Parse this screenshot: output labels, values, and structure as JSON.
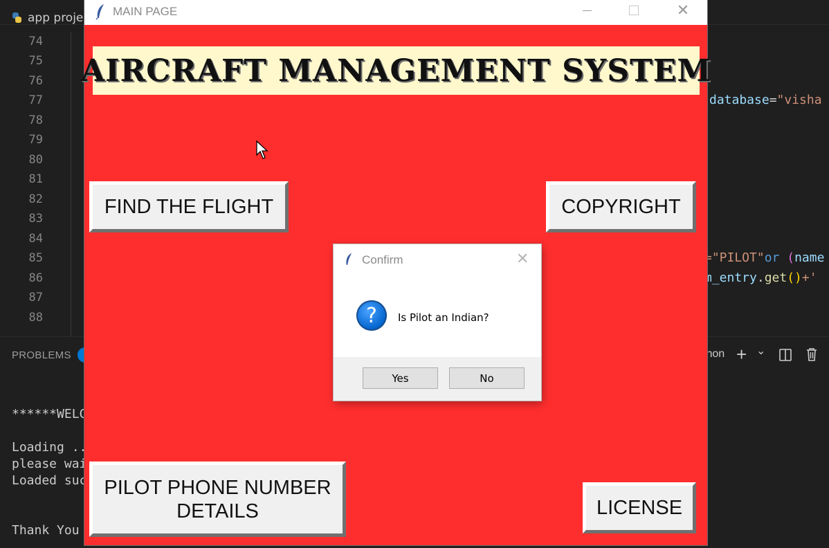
{
  "vscode": {
    "tab_title": "app proje",
    "line_numbers": [
      "74",
      "75",
      "76",
      "77",
      "78",
      "79",
      "80",
      "81",
      "82",
      "83",
      "84",
      "85",
      "86",
      "87",
      "88"
    ],
    "code": {
      "l77_attr": "database",
      "l77_eq": "=",
      "l77_str": "\"visha",
      "l85_str": "=\"PILOT\"",
      "l85_kw": "or",
      "l85_par": "(",
      "l85_attr": "name",
      "l86_attr": "m_entry",
      "l86_dot": ".",
      "l86_fn": "get",
      "l86_brk": "()",
      "l86_rest": "+'"
    },
    "panel": {
      "tab_label": "PROBLEMS",
      "right_text": "thon",
      "plus": "+",
      "chevron": "⌄"
    },
    "terminal_lines": [
      "******WELC",
      "",
      "Loading ..",
      "please wai",
      "Loaded suc",
      "",
      "",
      "Thank You"
    ]
  },
  "main_window": {
    "title": "MAIN PAGE",
    "banner": "AIRCRAFT MANAGEMENT SYSTEM",
    "buttons": {
      "find_flight": "FIND THE FLIGHT",
      "copyright": "COPYRIGHT",
      "pilot_phone_line1": "PILOT PHONE NUMBER",
      "pilot_phone_line2": "DETAILS",
      "license": "LICENSE"
    },
    "colors": {
      "background": "#ff2e2e",
      "banner_bg": "#fff8cc"
    }
  },
  "dialog": {
    "title": "Confirm",
    "message": "Is Pilot an Indian?",
    "yes_label": "Yes",
    "no_label": "No",
    "icon": "question-icon"
  }
}
